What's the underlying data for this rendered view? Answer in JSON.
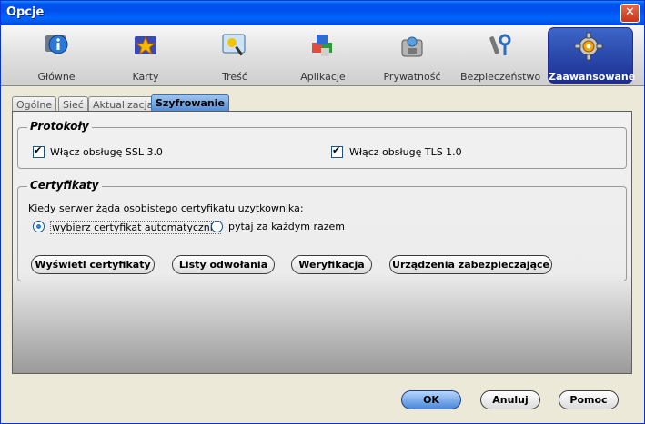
{
  "window": {
    "title": "Opcje"
  },
  "toolbar": {
    "items": [
      {
        "label": "Główne",
        "icon": "info-icon"
      },
      {
        "label": "Karty",
        "icon": "tabs-star-icon"
      },
      {
        "label": "Treść",
        "icon": "content-icon"
      },
      {
        "label": "Aplikacje",
        "icon": "applications-icon"
      },
      {
        "label": "Prywatność",
        "icon": "privacy-icon"
      },
      {
        "label": "Bezpieczeństwo",
        "icon": "security-icon"
      },
      {
        "label": "Zaawansowane",
        "icon": "gear-icon",
        "active": true
      }
    ]
  },
  "subtabs": [
    "Ogólne",
    "Sieć",
    "Aktualizacja",
    "Szyfrowanie"
  ],
  "subtab_selected": "Szyfrowanie",
  "protocols": {
    "legend": "Protokoły",
    "ssl": {
      "label": "Włącz obsługę SSL 3.0",
      "checked": true
    },
    "tls": {
      "label": "Włącz obsługę TLS 1.0",
      "checked": true
    }
  },
  "certificates": {
    "legend": "Certyfikaty",
    "prompt": "Kiedy serwer żąda osobistego certyfikatu użytkownika:",
    "radio_auto": {
      "label": "wybierz certyfikat automatycznie",
      "selected": true
    },
    "radio_ask": {
      "label": "pytaj za każdym razem",
      "selected": false
    },
    "buttons": {
      "view": "Wyświetl certyfikaty",
      "revocation": "Listy odwołania",
      "verify": "Weryfikacja",
      "devices": "Urządzenia zabezpieczające"
    }
  },
  "footer": {
    "ok": "OK",
    "cancel": "Anuluj",
    "help": "Pomoc"
  },
  "colors": {
    "titlebar": "#0053ee",
    "active_tool": "#1a2f90",
    "selected_tab": "#4b86d1"
  }
}
